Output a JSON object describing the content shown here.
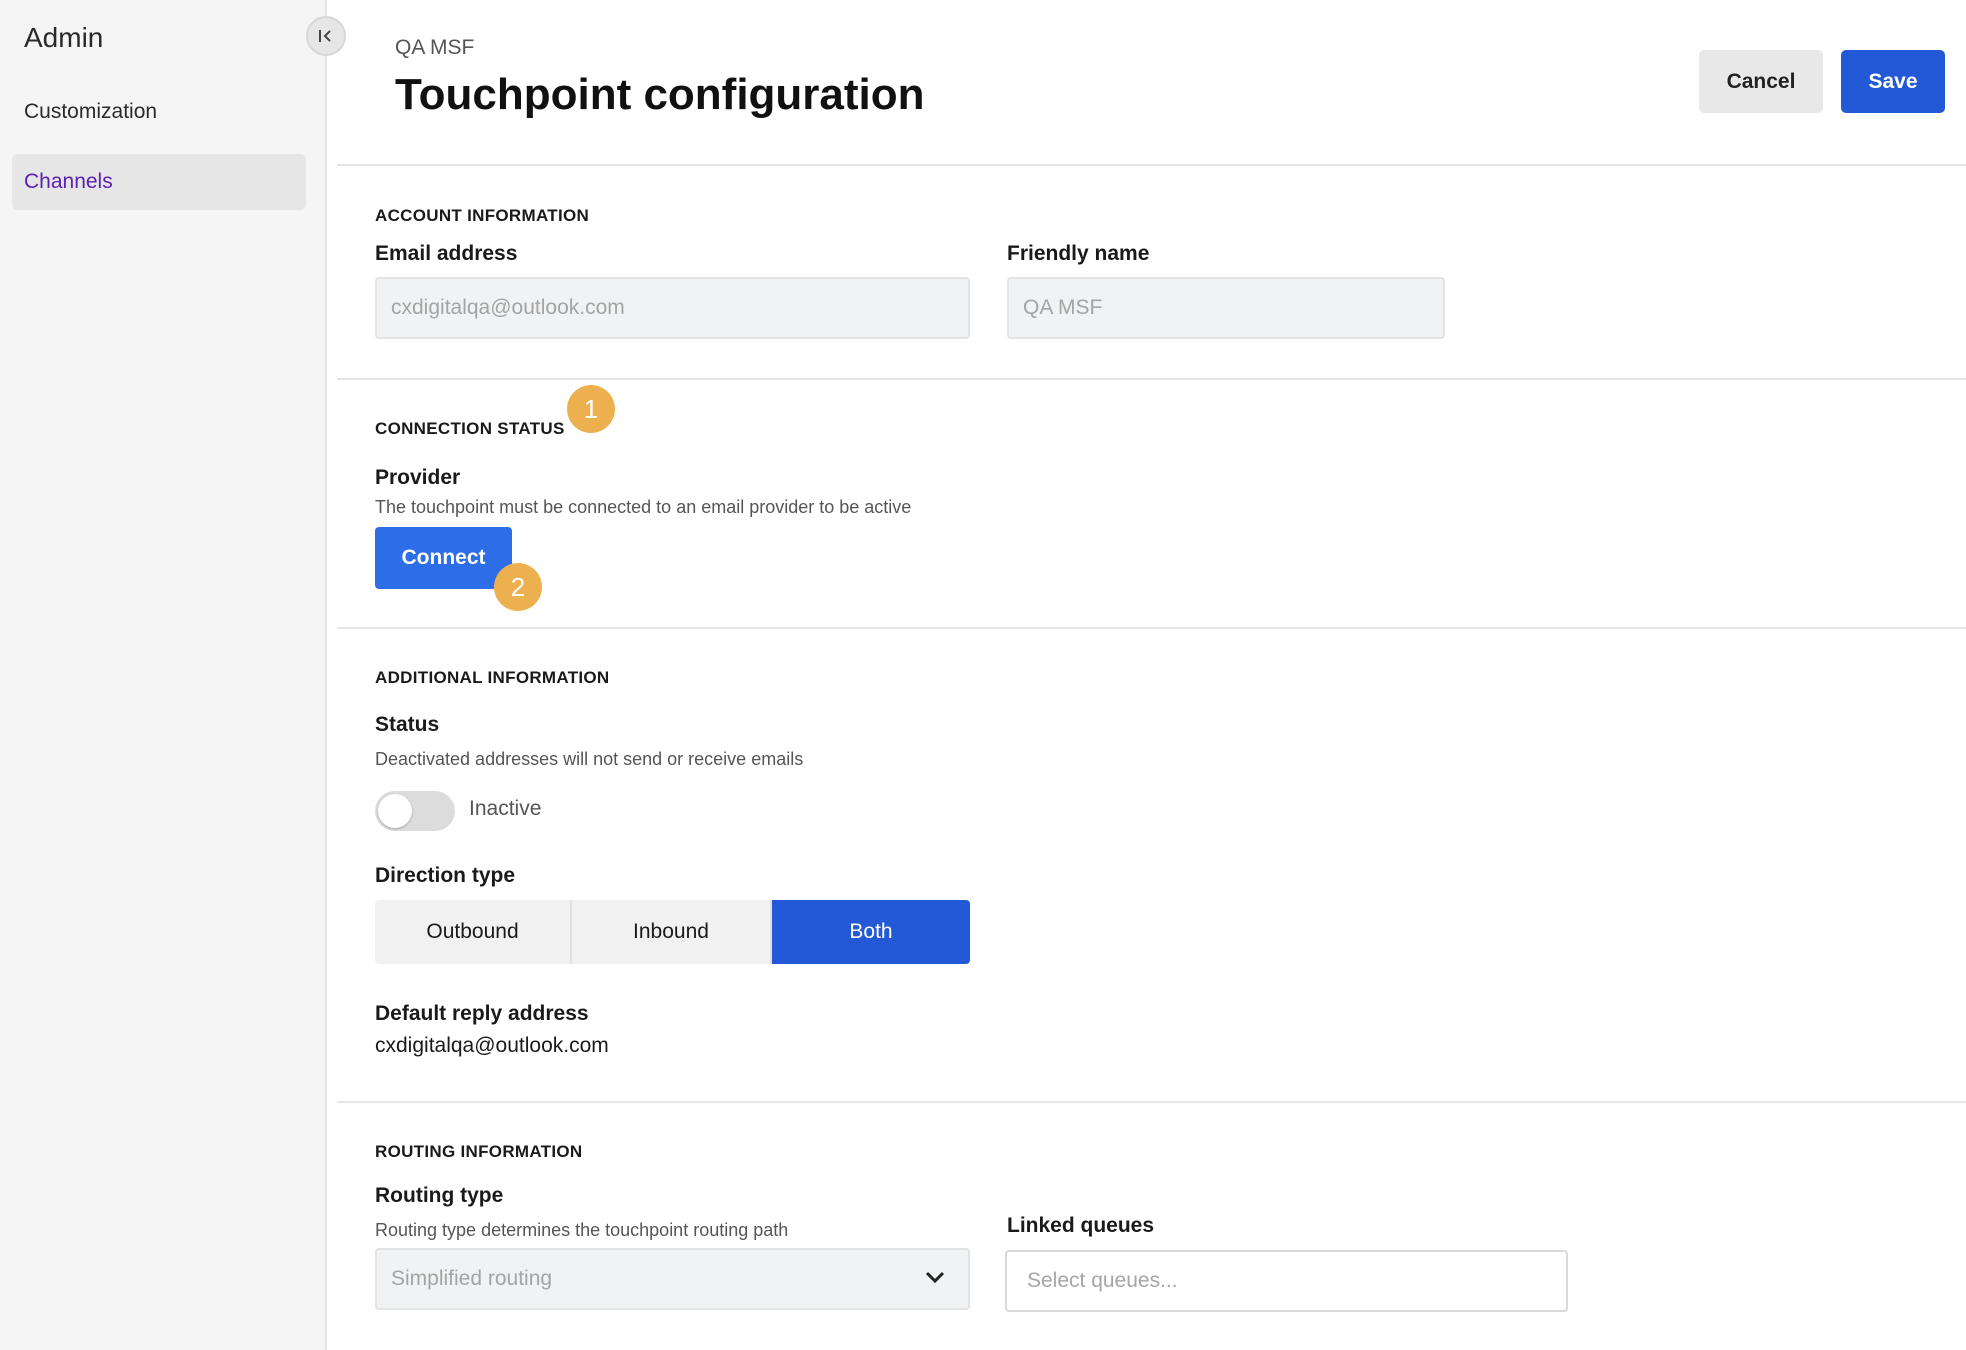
{
  "sidebar": {
    "title": "Admin",
    "items": [
      {
        "label": "Customization"
      },
      {
        "label": "Channels"
      }
    ]
  },
  "header": {
    "breadcrumb": "QA MSF",
    "title": "Touchpoint configuration",
    "cancel_label": "Cancel",
    "save_label": "Save"
  },
  "account": {
    "section_title": "ACCOUNT INFORMATION",
    "email_label": "Email address",
    "email_value": "cxdigitalqa@outlook.com",
    "friendly_label": "Friendly name",
    "friendly_value": "QA MSF"
  },
  "connection": {
    "section_title": "CONNECTION STATUS",
    "badge_1": "1",
    "provider_label": "Provider",
    "provider_help": "The touchpoint must be connected to an email provider to be active",
    "connect_label": "Connect",
    "badge_2": "2"
  },
  "additional": {
    "section_title": "ADDITIONAL INFORMATION",
    "status_label": "Status",
    "status_help": "Deactivated addresses will not send or receive emails",
    "status_value": "Inactive",
    "direction_label": "Direction type",
    "direction_options": [
      "Outbound",
      "Inbound",
      "Both"
    ],
    "direction_selected": "Both",
    "reply_label": "Default reply address",
    "reply_value": "cxdigitalqa@outlook.com"
  },
  "routing": {
    "section_title": "ROUTING INFORMATION",
    "type_label": "Routing type",
    "type_help": "Routing type determines the touchpoint routing path",
    "type_value": "Simplified routing",
    "queues_label": "Linked queues",
    "queues_placeholder": "Select queues..."
  },
  "colors": {
    "primary": "#2358d6",
    "connect": "#2d6ee8",
    "badge": "#ecb04f",
    "active_nav": "#5b21b6"
  }
}
